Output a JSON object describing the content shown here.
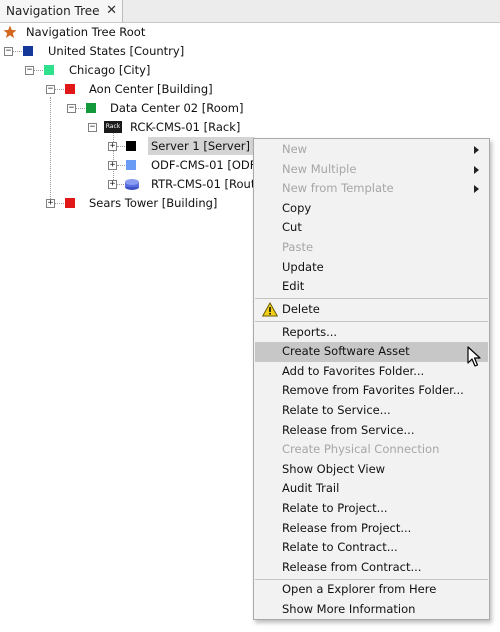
{
  "tab": {
    "title": "Navigation Tree",
    "close_glyph": "✕"
  },
  "tree": {
    "root": {
      "label": "Navigation Tree Root",
      "icon": "star-icon",
      "color": "#d4661e"
    },
    "nodes": [
      {
        "label": "United States [Country]",
        "color": "#14389a",
        "toggle": "−"
      },
      {
        "label": "Chicago [City]",
        "color": "#2de08c",
        "toggle": "−"
      },
      {
        "label": "Aon Center [Building]",
        "color": "#e21818",
        "toggle": "−"
      },
      {
        "label": "Data Center 02 [Room]",
        "color": "#139a3a",
        "toggle": "−"
      },
      {
        "label": "RCK-CMS-01 [Rack]",
        "icon_text": "Rack",
        "toggle": "−"
      },
      {
        "label": "Server 1 [Server]",
        "color": "#000000",
        "toggle": "+"
      },
      {
        "label": "ODF-CMS-01 [ODF",
        "color": "#6b9cf5",
        "toggle": "+"
      },
      {
        "label": "RTR-CMS-01 [Rout",
        "color": "#5a6fe0",
        "toggle": "+"
      },
      {
        "label": "Sears Tower [Building]",
        "color": "#e21818",
        "toggle": "+"
      }
    ]
  },
  "menu": {
    "items": [
      {
        "label": "New",
        "disabled": true,
        "submenu": true
      },
      {
        "label": "New Multiple",
        "disabled": true,
        "submenu": true
      },
      {
        "label": "New from Template",
        "disabled": true,
        "submenu": true
      },
      {
        "label": "Copy"
      },
      {
        "label": "Cut"
      },
      {
        "label": "Paste",
        "disabled": true
      },
      {
        "label": "Update"
      },
      {
        "label": "Edit"
      },
      {
        "label": "Delete",
        "icon": "warning-icon"
      },
      {
        "label": "Reports..."
      },
      {
        "label": "Create Software Asset",
        "highlighted": true
      },
      {
        "label": "Add to Favorites Folder..."
      },
      {
        "label": "Remove from Favorites Folder..."
      },
      {
        "label": "Relate to Service..."
      },
      {
        "label": "Release from Service..."
      },
      {
        "label": "Create Physical Connection",
        "disabled": true
      },
      {
        "label": "Show Object View"
      },
      {
        "label": "Audit Trail"
      },
      {
        "label": "Relate to Project..."
      },
      {
        "label": "Release from Project..."
      },
      {
        "label": "Relate to Contract..."
      },
      {
        "label": "Release from Contract..."
      },
      {
        "label": "Open a Explorer from Here"
      },
      {
        "label": "Show More Information"
      }
    ]
  }
}
